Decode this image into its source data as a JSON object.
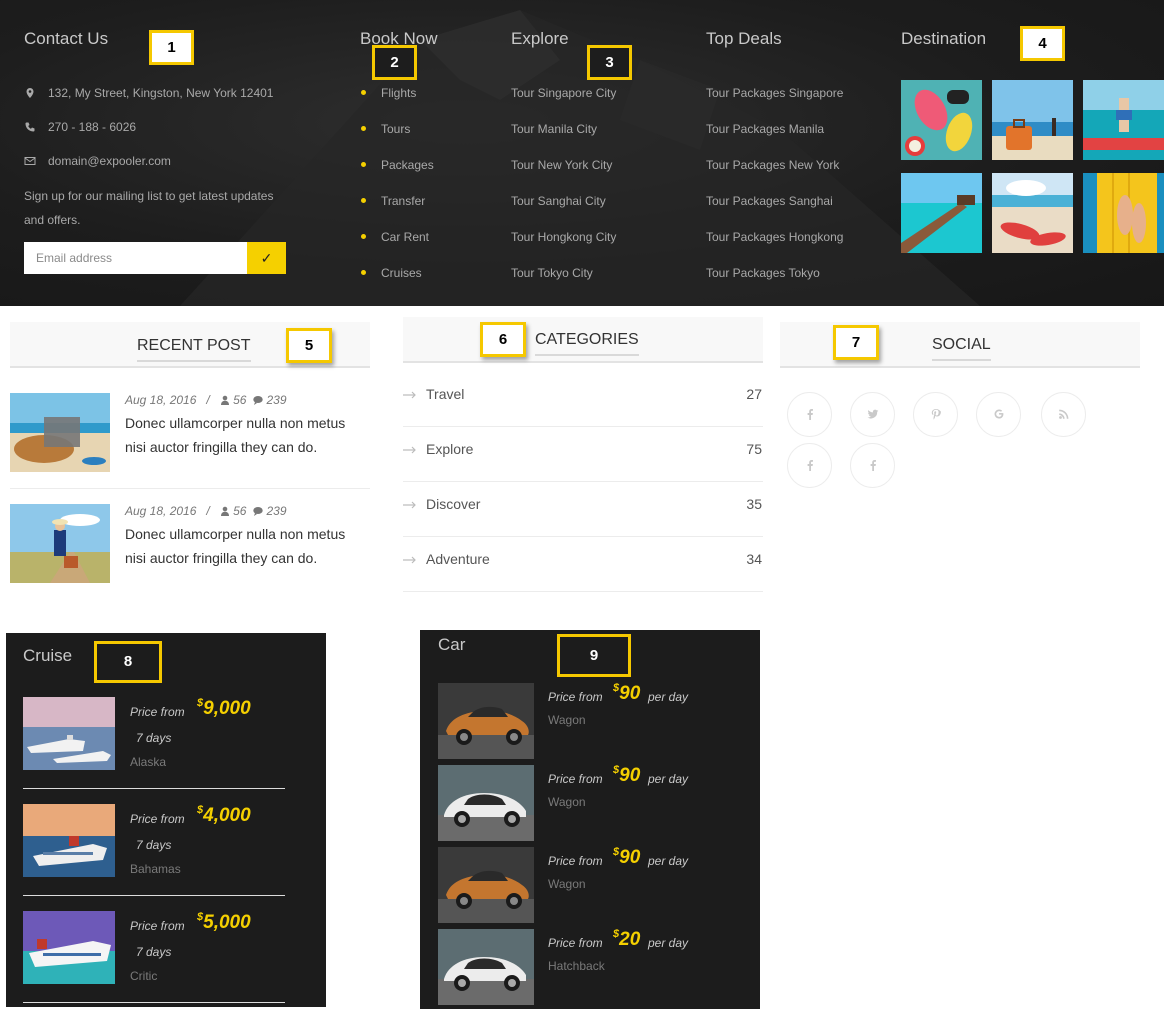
{
  "annotations": [
    "1",
    "2",
    "3",
    "4",
    "5",
    "6",
    "7",
    "8",
    "9"
  ],
  "footer": {
    "contact": {
      "title": "Contact Us",
      "address": "132, My Street, Kingston, New York 12401",
      "phone": "270 - 188 - 6026",
      "email": "domain@expooler.com",
      "signup_text": "Sign up for our mailing list to get latest updates and offers.",
      "email_placeholder": "Email address",
      "submit_icon": "✓"
    },
    "book_now": {
      "title": "Book Now",
      "items": [
        "Flights",
        "Tours",
        "Packages",
        "Transfer",
        "Car Rent",
        "Cruises"
      ]
    },
    "explore": {
      "title": "Explore",
      "items": [
        "Tour Singapore City",
        "Tour Manila City",
        "Tour New York City",
        "Tour Sanghai City",
        "Tour Hongkong City",
        "Tour Tokyo City"
      ]
    },
    "top_deals": {
      "title": "Top Deals",
      "items": [
        "Tour Packages Singapore",
        "Tour Packages Manila",
        "Tour Packages New York",
        "Tour Packages Sanghai",
        "Tour Packages Hongkong",
        "Tour Packages Tokyo"
      ]
    },
    "destination": {
      "title": "Destination",
      "thumbs": [
        "beach-flipflops",
        "beach-suitcase",
        "pool-woman",
        "pier-sea",
        "beach-sandals",
        "yellow-float"
      ]
    }
  },
  "recent_post": {
    "title": "RECENT POST",
    "posts": [
      {
        "date": "Aug 18, 2016",
        "sep": "/",
        "views": "56",
        "comments": "239",
        "text": "Donec ullamcorper nulla non metus nisi auctor fringilla they can do."
      },
      {
        "date": "Aug 18, 2016",
        "sep": "/",
        "views": "56",
        "comments": "239",
        "text": "Donec ullamcorper nulla non metus nisi auctor fringilla they can do."
      }
    ]
  },
  "categories": {
    "title": "CATEGORIES",
    "items": [
      {
        "label": "Travel",
        "count": "27"
      },
      {
        "label": "Explore",
        "count": "75"
      },
      {
        "label": "Discover",
        "count": "35"
      },
      {
        "label": "Adventure",
        "count": "34"
      }
    ]
  },
  "social": {
    "title": "SOCIAL",
    "icons": [
      "facebook-icon",
      "twitter-icon",
      "pinterest-icon",
      "google-icon",
      "rss-icon",
      "facebook-icon",
      "facebook-icon"
    ]
  },
  "cruise": {
    "title": "Cruise",
    "price_from_label": "Price from",
    "currency": "$",
    "items": [
      {
        "price": "9,000",
        "duration": "7 days",
        "destination": "Alaska"
      },
      {
        "price": "4,000",
        "duration": "7 days",
        "destination": "Bahamas"
      },
      {
        "price": "5,000",
        "duration": "7 days",
        "destination": "Critic"
      }
    ]
  },
  "car": {
    "title": "Car",
    "price_from_label": "Price from",
    "currency": "$",
    "per_day_label": "per day",
    "items": [
      {
        "price": "90",
        "type": "Wagon",
        "color": "orange"
      },
      {
        "price": "90",
        "type": "Wagon",
        "color": "white"
      },
      {
        "price": "90",
        "type": "Wagon",
        "color": "orange"
      },
      {
        "price": "20",
        "type": "Hatchback",
        "color": "white"
      }
    ]
  },
  "colors": {
    "accent": "#f5d000",
    "footer_bg": "#1d1d1d",
    "annotation_border": "#f5c800"
  }
}
